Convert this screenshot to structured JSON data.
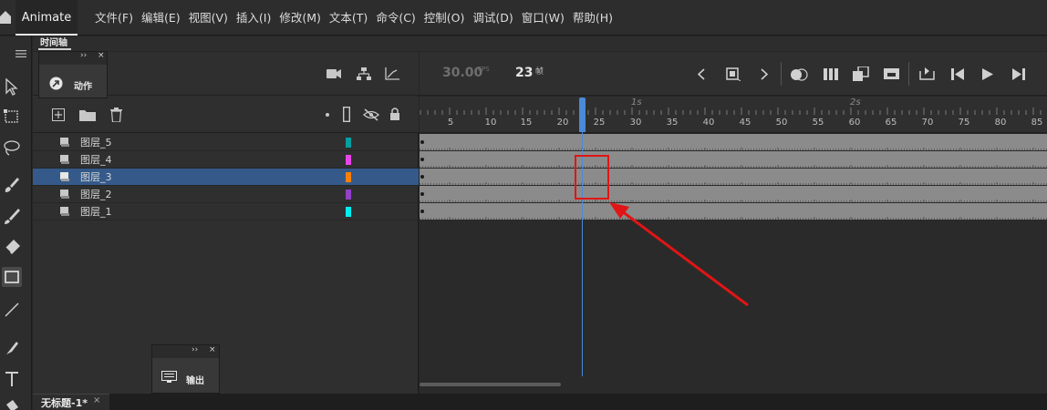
{
  "menubar": {
    "app_name": "Animate",
    "items": [
      "文件(F)",
      "编辑(E)",
      "视图(V)",
      "插入(I)",
      "修改(M)",
      "文本(T)",
      "命令(C)",
      "控制(O)",
      "调试(D)",
      "窗口(W)",
      "帮助(H)"
    ]
  },
  "panel": {
    "title": "时间轴"
  },
  "actions_panel": {
    "label": "动作",
    "icon": "actions-arrow-icon"
  },
  "output_panel": {
    "label": "输出",
    "icon": "monitor-icon"
  },
  "timeline": {
    "fps": "30.00",
    "fps_unit": "FPS",
    "current_frame": "23",
    "frame_unit": "帧",
    "ruler_seconds": [
      "1s",
      "2s"
    ],
    "ruler_numbers": [
      "5",
      "10",
      "15",
      "20",
      "25",
      "30",
      "35",
      "40",
      "45",
      "50",
      "55",
      "60",
      "65",
      "70",
      "75",
      "80",
      "85"
    ]
  },
  "layers": [
    {
      "name": "图层_5",
      "color": "#00a0a0",
      "selected": false
    },
    {
      "name": "图层_4",
      "color": "#e845e8",
      "selected": false
    },
    {
      "name": "图层_3",
      "color": "#ff8000",
      "selected": true
    },
    {
      "name": "图层_2",
      "color": "#9440c8",
      "selected": false
    },
    {
      "name": "图层_1",
      "color": "#00f0f0",
      "selected": false
    }
  ],
  "document": {
    "tab_title": "无标题-1*",
    "close": "×"
  },
  "annotation": {
    "color": "#e01515"
  },
  "accent_color": "#4a8ad8"
}
